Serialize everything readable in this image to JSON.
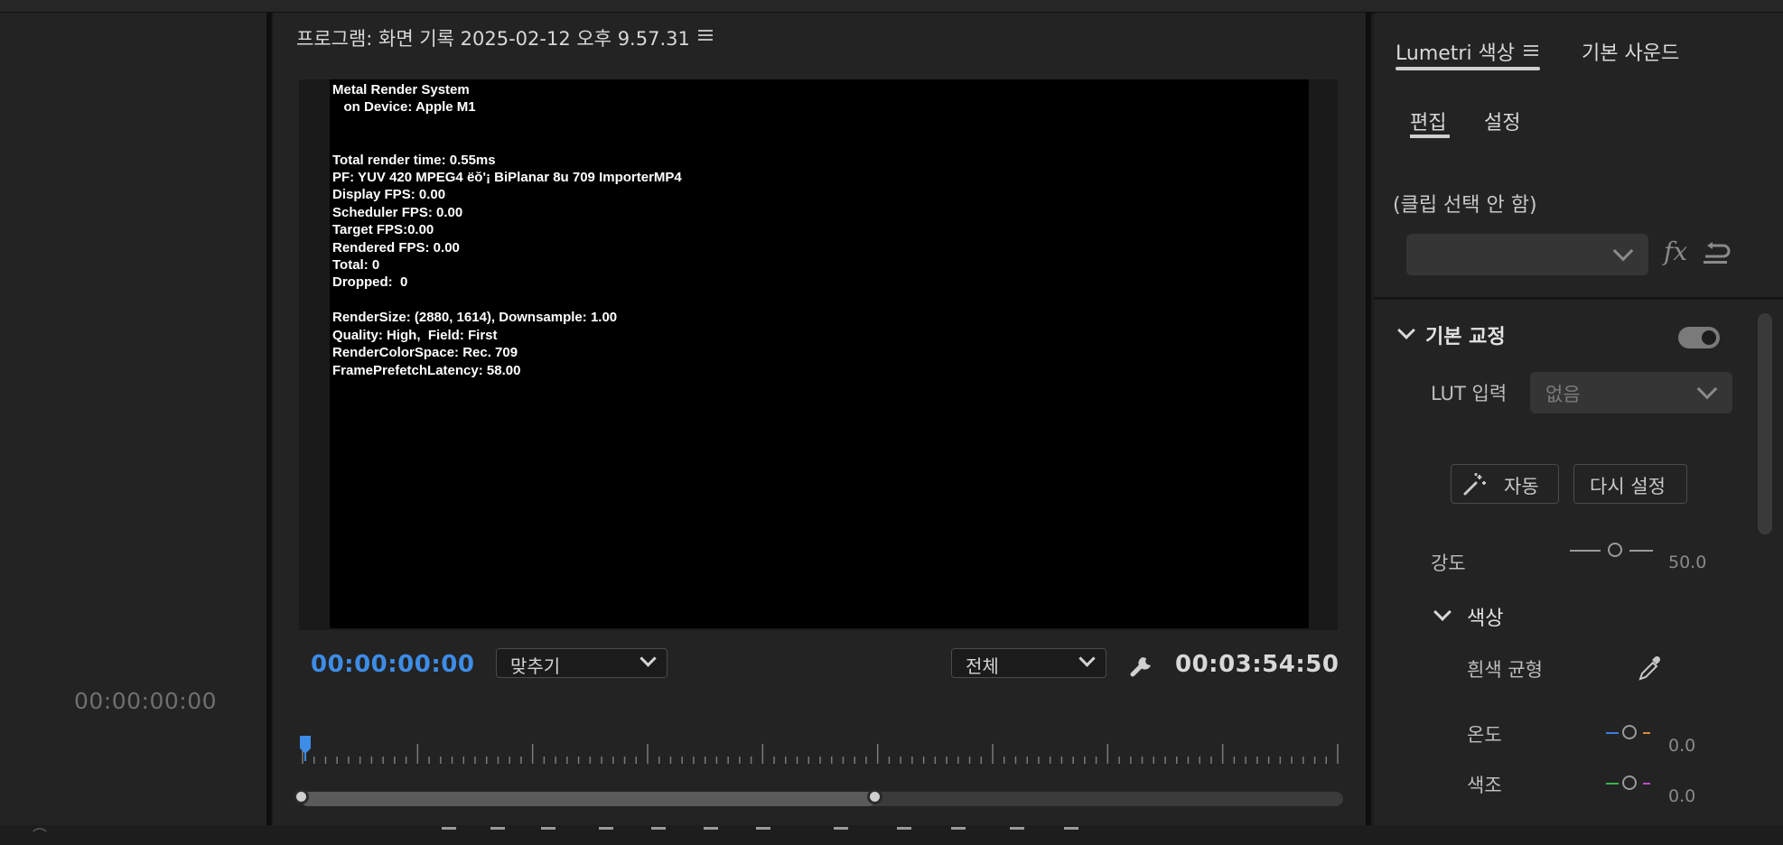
{
  "left_panel": {
    "timecode": "00:00:00:00"
  },
  "program_monitor": {
    "title": "프로그램: 화면 기록 2025-02-12 오후 9.57.31",
    "menu_icon": "hamburger-menu-icon",
    "overlay_lines": [
      "Metal Render System",
      "   on Device: Apple M1",
      "",
      "",
      "Total render time: 0.55ms",
      "PF: YUV 420 MPEG4 ëŏ'¡ BiPlanar 8u 709 ImporterMP4",
      "Display FPS: 0.00",
      "Scheduler FPS: 0.00",
      "Target FPS:0.00",
      "Rendered FPS: 0.00",
      "Total: 0",
      "Dropped:  0",
      "",
      "RenderSize: (2880, 1614), Downsample: 1.00",
      "Quality: High,  Field: First",
      "RenderColorSpace: Rec. 709",
      "FramePrefetchLatency: 58.00"
    ],
    "current_timecode": "00:00:00:00",
    "zoom_select": "맞추기",
    "resolution_select": "전체",
    "settings_icon": "wrench-icon",
    "duration_timecode": "00:03:54:50"
  },
  "lumetri": {
    "tabs": [
      {
        "label": "Lumetri 색상",
        "active": true
      },
      {
        "label": "기본 사운드",
        "active": false
      }
    ],
    "tab_menu_icon": "hamburger-menu-icon",
    "subtabs": [
      {
        "label": "편집",
        "active": true
      },
      {
        "label": "설정",
        "active": false
      }
    ],
    "clip_label": "(클립 선택 안 함)",
    "fx_icon": "fx",
    "reset_icon": "reset-icon",
    "basic_correction": {
      "heading": "기본 교정",
      "enabled": true,
      "lut_label": "LUT 입력",
      "lut_value": "없음",
      "auto_label": "자동",
      "reset_label": "다시 설정",
      "intensity_label": "강도",
      "intensity_value": "50.0",
      "color_heading": "색상",
      "white_balance_label": "흰색 균형",
      "eyedropper_icon": "eyedropper-icon",
      "temperature_label": "온도",
      "temperature_value": "0.0",
      "tint_label": "색조",
      "tint_value": "0.0"
    },
    "colors": {
      "temperature_left": "#3b7bd9",
      "temperature_right": "#d98a3b",
      "tint_left": "#3fb34f",
      "tint_right": "#b84fc2"
    }
  }
}
